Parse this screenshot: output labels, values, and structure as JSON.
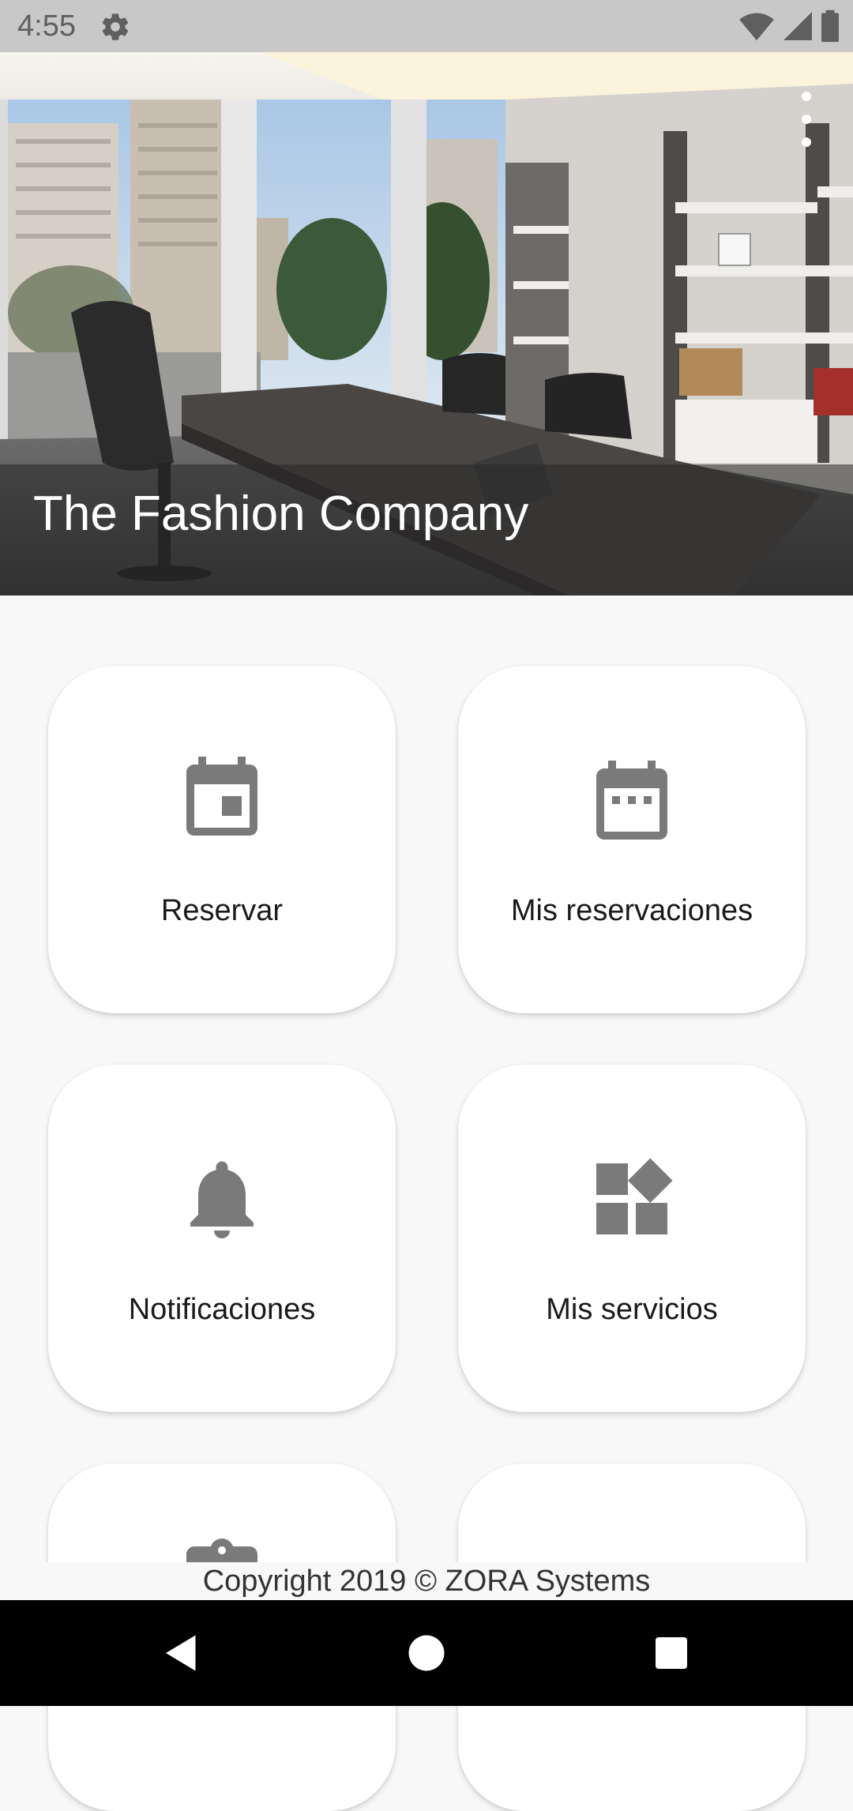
{
  "status_bar": {
    "time": "4:55",
    "icons": [
      "settings-icon",
      "wifi-icon",
      "signal-icon",
      "battery-icon"
    ]
  },
  "hero": {
    "title": "The Fashion Company",
    "menu_icon": "more-vert-icon"
  },
  "tiles": [
    {
      "label": "Reservar",
      "icon": "calendar-today-icon"
    },
    {
      "label": "Mis reservaciones",
      "icon": "calendar-view-icon"
    },
    {
      "label": "Notificaciones",
      "icon": "bell-icon"
    },
    {
      "label": "Mis servicios",
      "icon": "widgets-icon"
    },
    {
      "label": "",
      "icon": "clipboard-icon"
    },
    {
      "label": "",
      "icon": "unknown-icon"
    }
  ],
  "footer": {
    "copyright": "Copyright 2019 © ZORA Systems"
  },
  "nav": {
    "back": "back-icon",
    "home": "home-icon",
    "recents": "recents-icon"
  },
  "colors": {
    "icon_gray": "#7a7a7a",
    "background": "#f8f8f8",
    "card": "#ffffff",
    "status_bar": "#c8c8c8"
  }
}
